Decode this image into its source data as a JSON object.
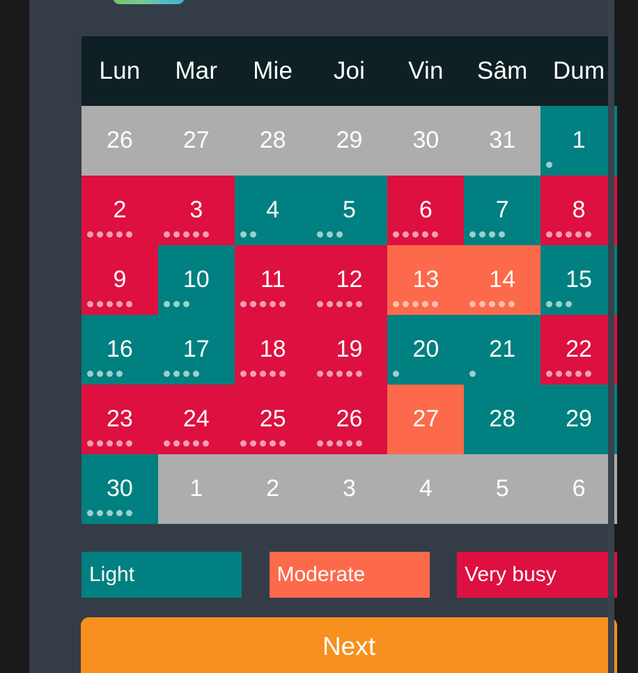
{
  "theme": {
    "page_bg": "#1a1a1a",
    "panel_bg": "#343c48",
    "header_bg": "#0e2024",
    "light_color": "#008080",
    "moderate_color": "#fc6a4b",
    "busy_color": "#dd1040",
    "muted_color": "#adadad",
    "next_color": "#f7901e"
  },
  "calendar": {
    "weekday_headers": [
      "Lun",
      "Mar",
      "Mie",
      "Joi",
      "Vin",
      "Sâm",
      "Dum"
    ],
    "weeks": [
      [
        {
          "day": "26",
          "state": "muted",
          "dots": 0
        },
        {
          "day": "27",
          "state": "muted",
          "dots": 0
        },
        {
          "day": "28",
          "state": "muted",
          "dots": 0
        },
        {
          "day": "29",
          "state": "muted",
          "dots": 0
        },
        {
          "day": "30",
          "state": "muted",
          "dots": 0
        },
        {
          "day": "31",
          "state": "muted",
          "dots": 0
        },
        {
          "day": "1",
          "state": "light",
          "dots": 1
        }
      ],
      [
        {
          "day": "2",
          "state": "busy",
          "dots": 5
        },
        {
          "day": "3",
          "state": "busy",
          "dots": 5
        },
        {
          "day": "4",
          "state": "light",
          "dots": 2
        },
        {
          "day": "5",
          "state": "light",
          "dots": 3
        },
        {
          "day": "6",
          "state": "busy",
          "dots": 5
        },
        {
          "day": "7",
          "state": "light",
          "dots": 4
        },
        {
          "day": "8",
          "state": "busy",
          "dots": 5
        }
      ],
      [
        {
          "day": "9",
          "state": "busy",
          "dots": 5
        },
        {
          "day": "10",
          "state": "light",
          "dots": 3
        },
        {
          "day": "11",
          "state": "busy",
          "dots": 5
        },
        {
          "day": "12",
          "state": "busy",
          "dots": 5
        },
        {
          "day": "13",
          "state": "moderate",
          "dots": 5
        },
        {
          "day": "14",
          "state": "moderate",
          "dots": 5
        },
        {
          "day": "15",
          "state": "light",
          "dots": 3
        }
      ],
      [
        {
          "day": "16",
          "state": "light",
          "dots": 4
        },
        {
          "day": "17",
          "state": "light",
          "dots": 4
        },
        {
          "day": "18",
          "state": "busy",
          "dots": 5
        },
        {
          "day": "19",
          "state": "busy",
          "dots": 5
        },
        {
          "day": "20",
          "state": "light",
          "dots": 1
        },
        {
          "day": "21",
          "state": "light",
          "dots": 1
        },
        {
          "day": "22",
          "state": "busy",
          "dots": 5
        }
      ],
      [
        {
          "day": "23",
          "state": "busy",
          "dots": 5
        },
        {
          "day": "24",
          "state": "busy",
          "dots": 5
        },
        {
          "day": "25",
          "state": "busy",
          "dots": 5
        },
        {
          "day": "26",
          "state": "busy",
          "dots": 5
        },
        {
          "day": "27",
          "state": "moderate",
          "dots": 0
        },
        {
          "day": "28",
          "state": "light",
          "dots": 0
        },
        {
          "day": "29",
          "state": "light",
          "dots": 0
        }
      ],
      [
        {
          "day": "30",
          "state": "light",
          "dots": 5
        },
        {
          "day": "1",
          "state": "muted",
          "dots": 0
        },
        {
          "day": "2",
          "state": "muted",
          "dots": 0
        },
        {
          "day": "3",
          "state": "muted",
          "dots": 0
        },
        {
          "day": "4",
          "state": "muted",
          "dots": 0
        },
        {
          "day": "5",
          "state": "muted",
          "dots": 0
        },
        {
          "day": "6",
          "state": "muted",
          "dots": 0
        }
      ]
    ]
  },
  "legend": {
    "items": [
      {
        "label": "Light",
        "state": "light"
      },
      {
        "label": "Moderate",
        "state": "moderate"
      },
      {
        "label": "Very busy",
        "state": "busy"
      }
    ]
  },
  "footer": {
    "next_label": "Next"
  }
}
